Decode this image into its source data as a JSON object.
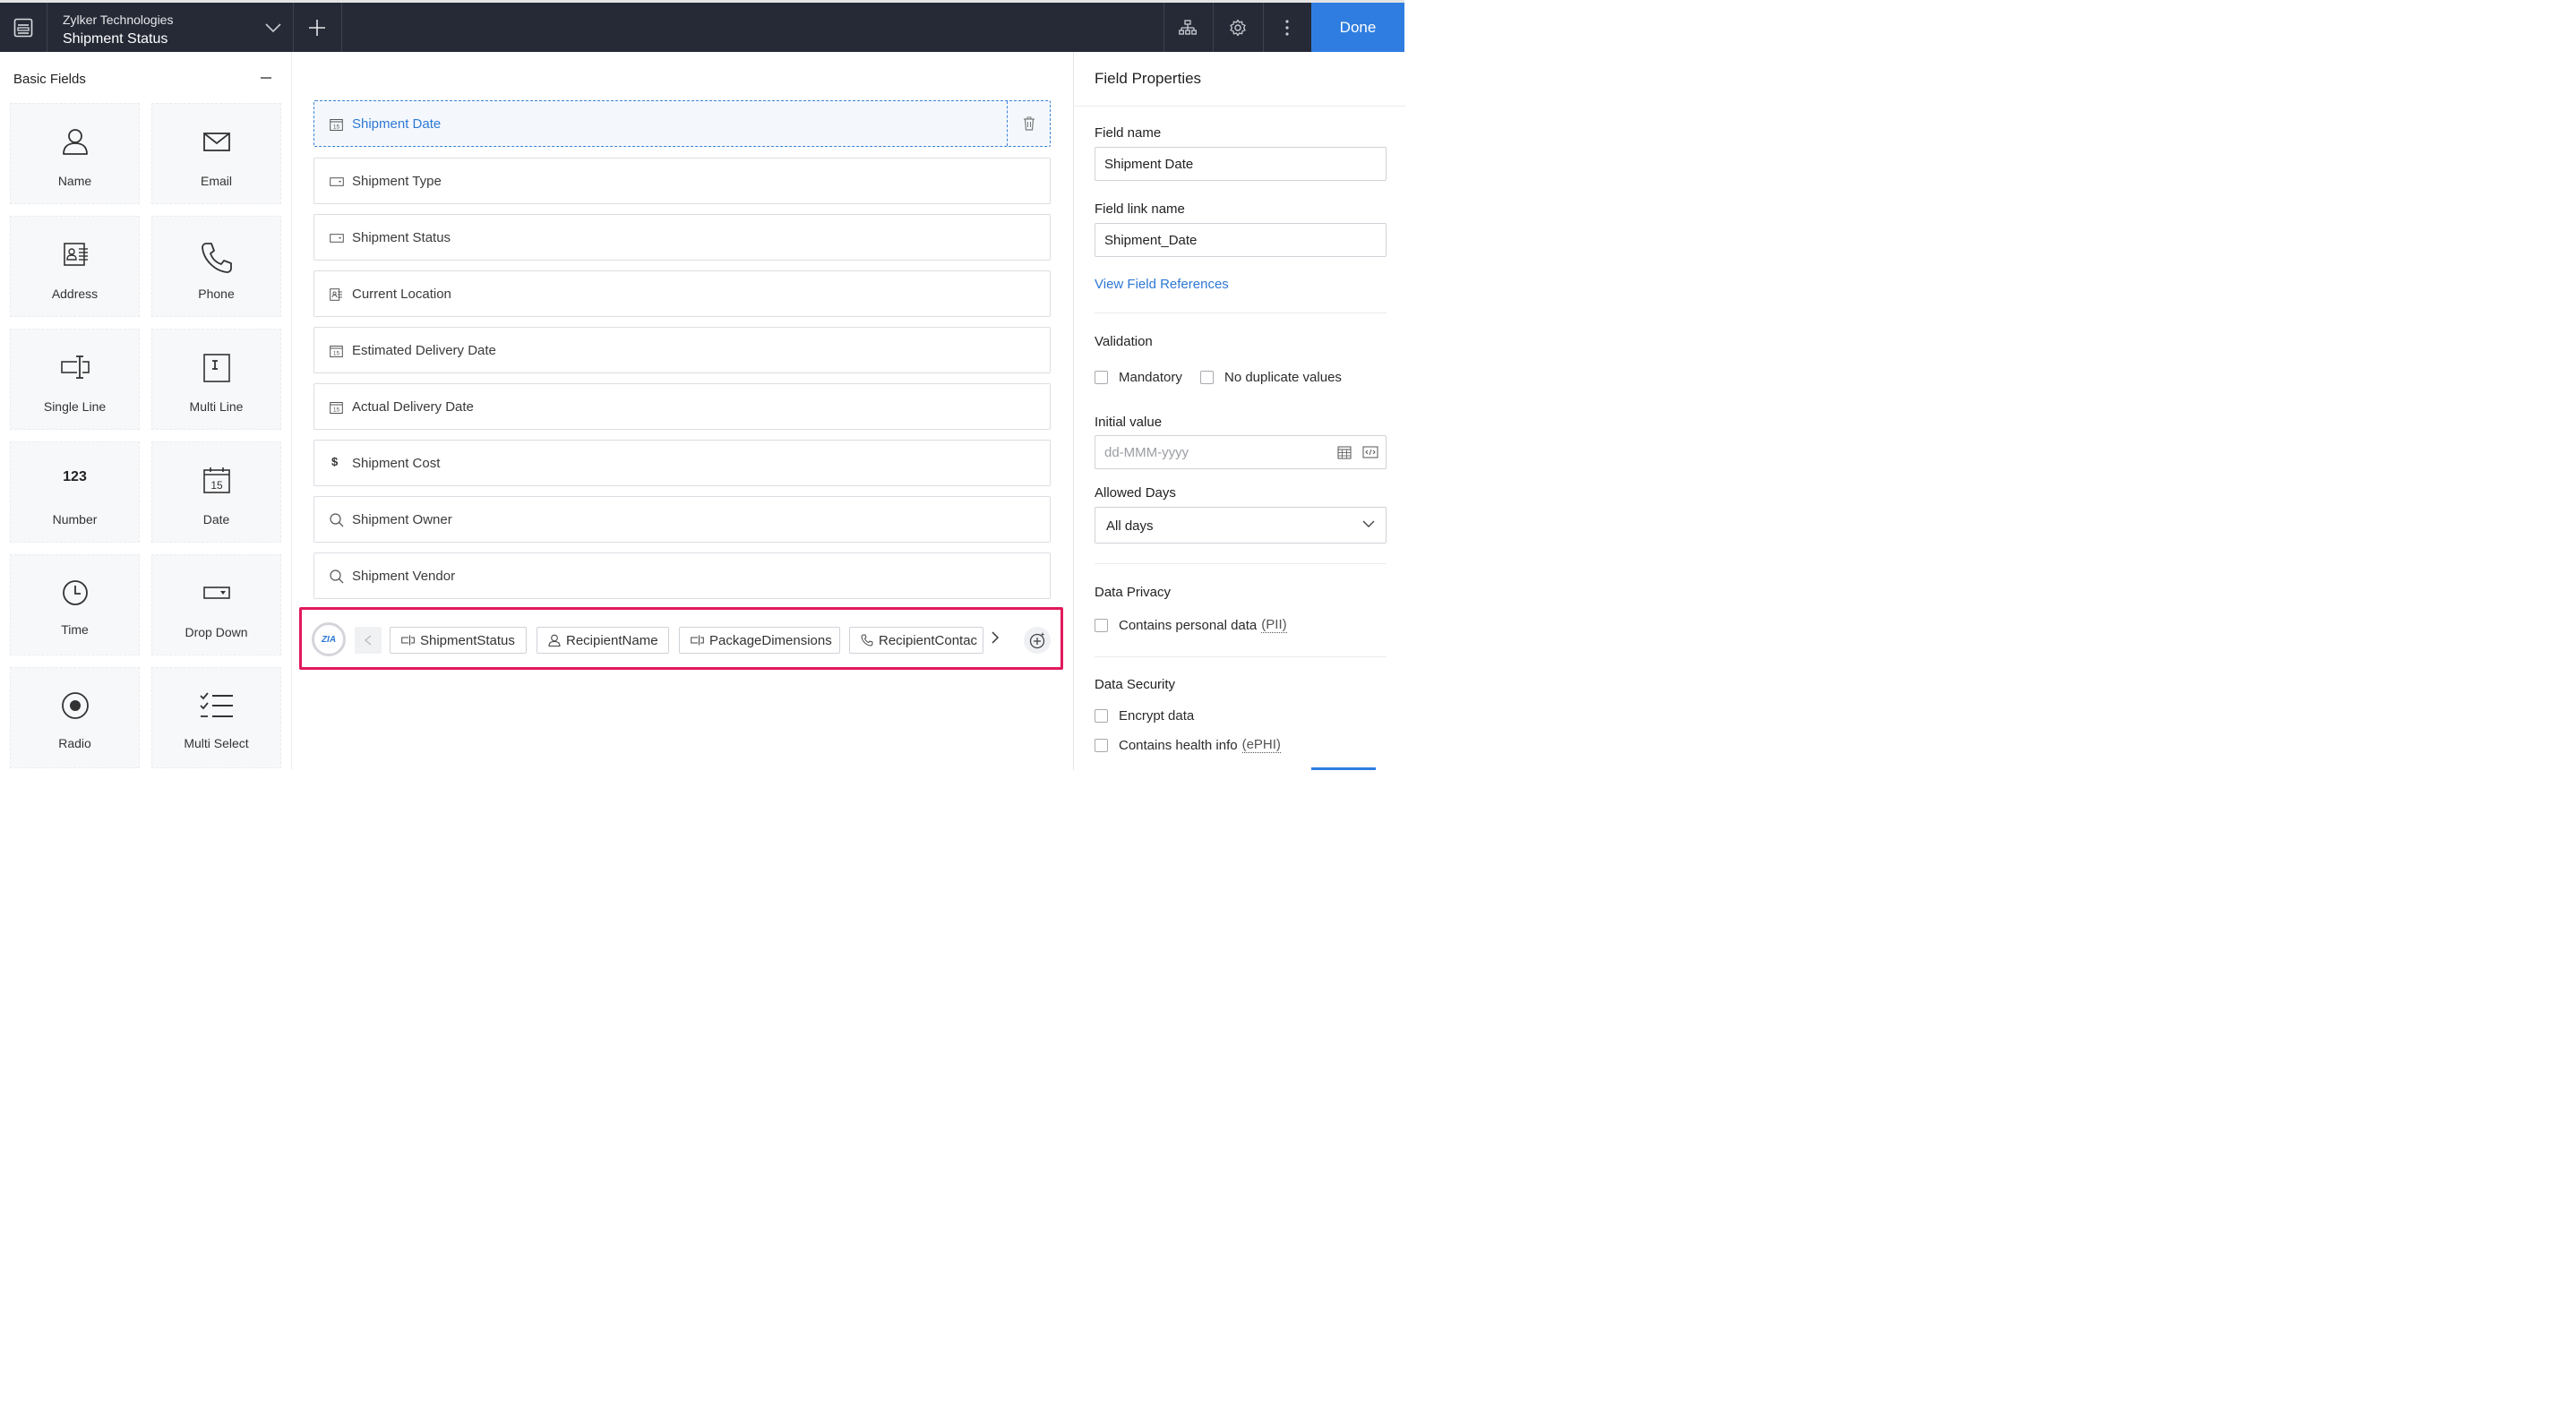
{
  "header": {
    "app_name": "Zylker Technologies",
    "form_name": "Shipment Status",
    "done_label": "Done"
  },
  "palette": {
    "title": "Basic Fields",
    "fields": [
      {
        "label": "Name",
        "icon": "person-icon"
      },
      {
        "label": "Email",
        "icon": "envelope-icon"
      },
      {
        "label": "Address",
        "icon": "address-card-icon"
      },
      {
        "label": "Phone",
        "icon": "phone-icon"
      },
      {
        "label": "Single Line",
        "icon": "single-line-icon"
      },
      {
        "label": "Multi Line",
        "icon": "multi-line-icon"
      },
      {
        "label": "Number",
        "icon": "number-icon",
        "glyph": "123"
      },
      {
        "label": "Date",
        "icon": "calendar-icon",
        "glyph": "15"
      },
      {
        "label": "Time",
        "icon": "clock-icon"
      },
      {
        "label": "Drop Down",
        "icon": "dropdown-icon"
      },
      {
        "label": "Radio",
        "icon": "radio-icon"
      },
      {
        "label": "Multi Select",
        "icon": "checklist-icon"
      }
    ]
  },
  "form": {
    "rows": [
      {
        "label": "Shipment Date",
        "icon": "calendar-icon",
        "selected": true
      },
      {
        "label": "Shipment Type",
        "icon": "dropdown-icon"
      },
      {
        "label": "Shipment Status",
        "icon": "dropdown-icon"
      },
      {
        "label": "Current Location",
        "icon": "address-card-icon"
      },
      {
        "label": "Estimated Delivery Date",
        "icon": "calendar-icon"
      },
      {
        "label": "Actual Delivery Date",
        "icon": "calendar-icon"
      },
      {
        "label": "Shipment Cost",
        "icon": "dollar-icon"
      },
      {
        "label": "Shipment Owner",
        "icon": "search-icon"
      },
      {
        "label": "Shipment Vendor",
        "icon": "search-icon"
      }
    ],
    "suggestions": {
      "badge_text": "ZIA",
      "chips": [
        {
          "label": "ShipmentStatus",
          "icon": "single-line-icon"
        },
        {
          "label": "RecipientName",
          "icon": "person-icon"
        },
        {
          "label": "PackageDimensions",
          "icon": "single-line-icon"
        },
        {
          "label": "RecipientContac",
          "icon": "phone-icon"
        }
      ]
    }
  },
  "properties": {
    "title": "Field Properties",
    "field_name_label": "Field name",
    "field_name_value": "Shipment Date",
    "link_name_label": "Field link name",
    "link_name_value": "Shipment_Date",
    "view_references": "View Field References",
    "validation_title": "Validation",
    "mandatory": "Mandatory",
    "no_duplicate": "No duplicate values",
    "initial_value_label": "Initial value",
    "initial_value_placeholder": "dd-MMM-yyyy",
    "allowed_days_label": "Allowed Days",
    "allowed_days_value": "All days",
    "privacy_title": "Data Privacy",
    "personal_data": "Contains personal data",
    "pii": "(PII)",
    "security_title": "Data Security",
    "encrypt": "Encrypt data",
    "health_info": "Contains health info",
    "ephi": "(ePHI)"
  },
  "colors": {
    "topbar": "#252a36",
    "accent": "#2f7de1",
    "highlight_border": "#e11a5b"
  }
}
